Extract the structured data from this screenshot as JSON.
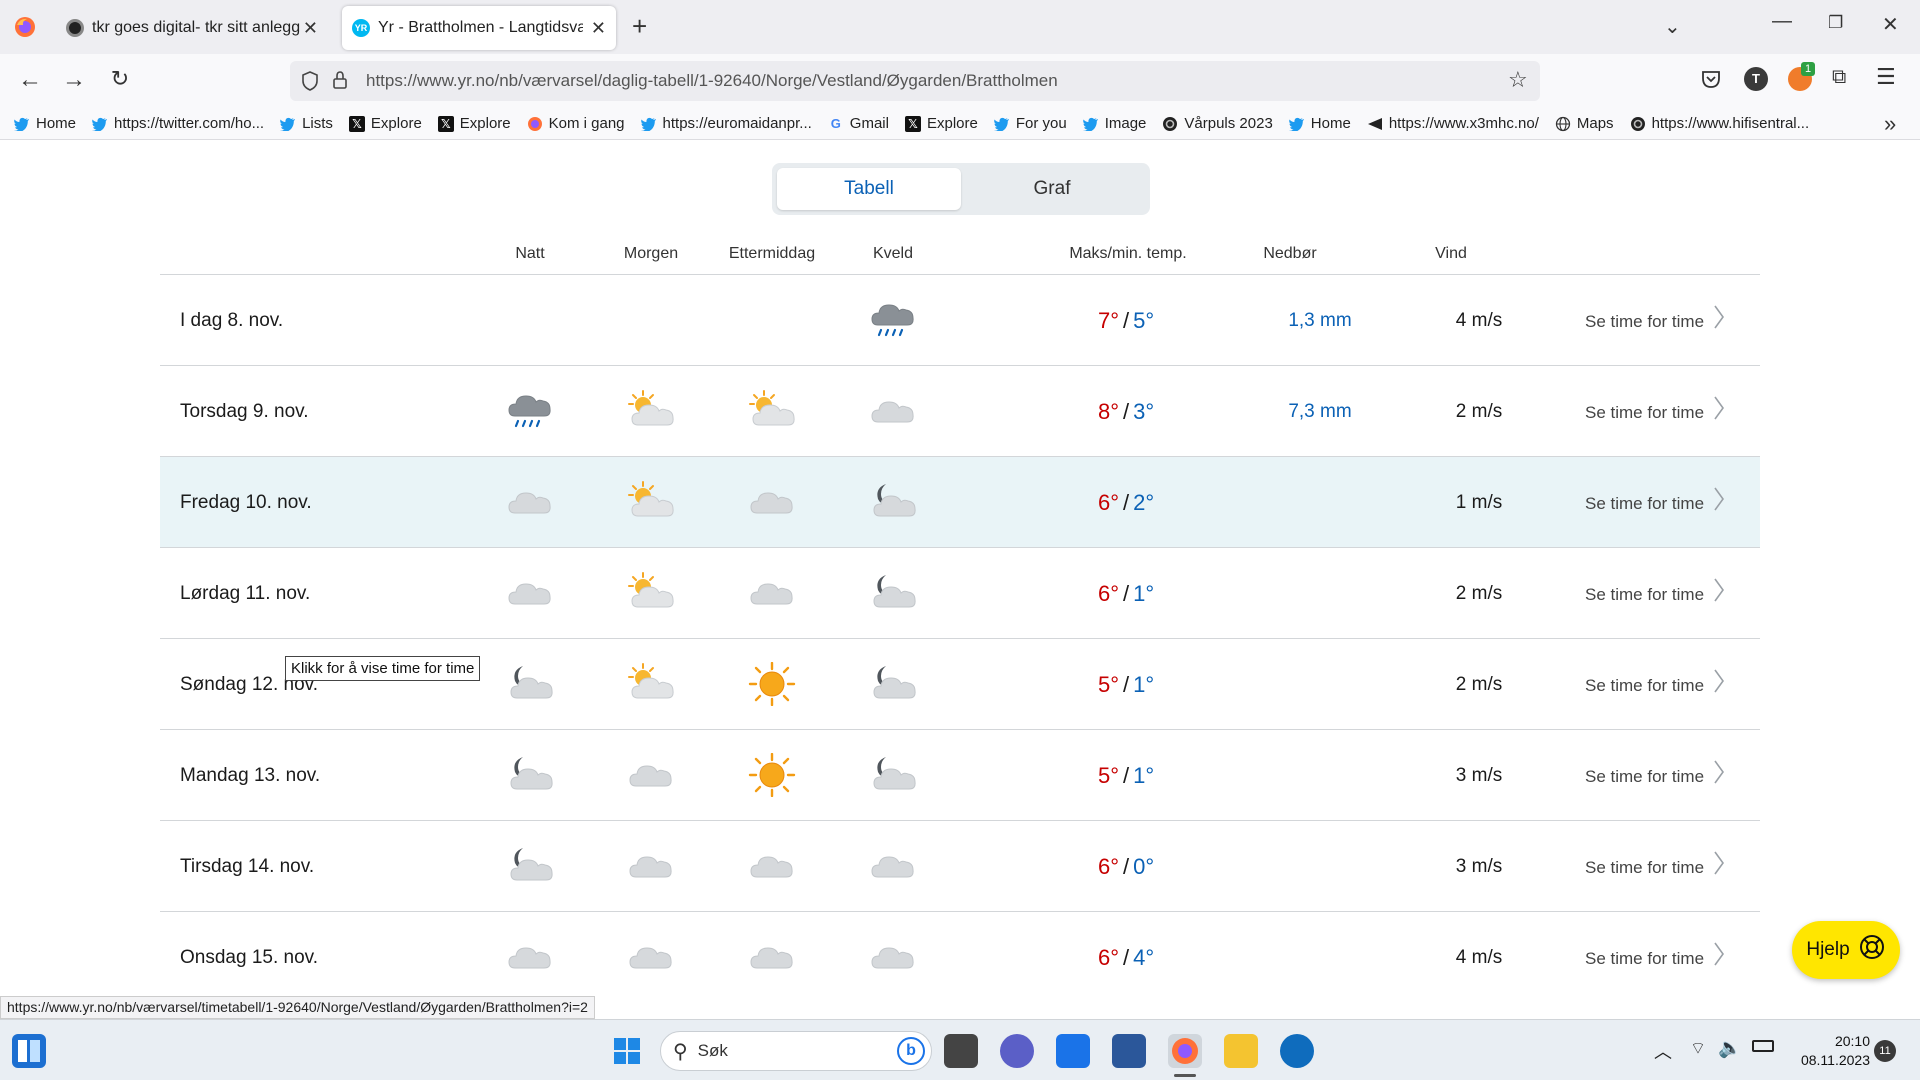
{
  "browser": {
    "tabs": [
      {
        "title": "tkr goes digital- tkr sitt anlegg",
        "active": false
      },
      {
        "title": "Yr - Brattholmen - Langtidsvarsel",
        "active": true
      }
    ],
    "new_tab": "+",
    "url": "https://www.yr.no/nb/værvarsel/daglig-tabell/1-92640/Norge/Vestland/Øygarden/Brattholmen",
    "profile_letter": "T",
    "extension_badge": "1",
    "bookmarks": [
      {
        "label": "Home",
        "icon": "twitter-icon"
      },
      {
        "label": "https://twitter.com/ho...",
        "icon": "twitter-icon"
      },
      {
        "label": "Lists",
        "icon": "twitter-icon"
      },
      {
        "label": "Explore",
        "icon": "x-icon"
      },
      {
        "label": "Explore",
        "icon": "x-icon"
      },
      {
        "label": "Kom i gang",
        "icon": "firefox-icon"
      },
      {
        "label": "https://euromaidanpr...",
        "icon": "twitter-icon"
      },
      {
        "label": "Gmail",
        "icon": "google-icon"
      },
      {
        "label": "Explore",
        "icon": "x-icon"
      },
      {
        "label": "For you",
        "icon": "twitter-icon"
      },
      {
        "label": "Image",
        "icon": "twitter-icon"
      },
      {
        "label": "Vårpuls 2023",
        "icon": "circle-icon"
      },
      {
        "label": "Home",
        "icon": "twitter-icon"
      },
      {
        "label": "https://www.x3mhc.no/",
        "icon": "triangle-icon"
      },
      {
        "label": "Maps",
        "icon": "globe-icon"
      },
      {
        "label": "https://www.hifisentral...",
        "icon": "circle-icon"
      }
    ],
    "overflow": "»",
    "status_url": "https://www.yr.no/nb/værvarsel/timetabell/1-92640/Norge/Vestland/Øygarden/Brattholmen?i=2"
  },
  "page": {
    "toggle": {
      "table_label": "Tabell",
      "graph_label": "Graf",
      "selected": "Tabell"
    },
    "columns": {
      "night": "Natt",
      "morning": "Morgen",
      "afternoon": "Ettermiddag",
      "evening": "Kveld",
      "temp": "Maks/min. temp.",
      "precip": "Nedbør",
      "wind": "Vind"
    },
    "rows": [
      {
        "day": "I dag 8. nov.",
        "icons": [
          "",
          "",
          "",
          "rain-cloud-icon"
        ],
        "max": "7°",
        "min": "5°",
        "precip": "1,3 mm",
        "wind": "4 m/s",
        "link": "Se time for time"
      },
      {
        "day": "Torsdag 9. nov.",
        "icons": [
          "rain-cloud-icon",
          "sun-cloud-icon",
          "sun-cloud-icon",
          "cloud-icon"
        ],
        "max": "8°",
        "min": "3°",
        "precip": "7,3 mm",
        "wind": "2 m/s",
        "link": "Se time for time"
      },
      {
        "day": "Fredag 10. nov.",
        "icons": [
          "cloud-icon",
          "sun-cloud-icon",
          "cloud-icon",
          "moon-cloud-icon"
        ],
        "max": "6°",
        "min": "2°",
        "precip": "",
        "wind": "1 m/s",
        "link": "Se time for time",
        "highlighted": true
      },
      {
        "day": "Lørdag 11. nov.",
        "icons": [
          "cloud-icon",
          "sun-cloud-icon",
          "cloud-icon",
          "moon-cloud-icon"
        ],
        "max": "6°",
        "min": "1°",
        "precip": "",
        "wind": "2 m/s",
        "link": "Se time for time"
      },
      {
        "day": "Søndag 12. nov.",
        "icons": [
          "moon-cloud-icon",
          "sun-cloud-icon",
          "sun-icon",
          "moon-cloud-icon"
        ],
        "max": "5°",
        "min": "1°",
        "precip": "",
        "wind": "2 m/s",
        "link": "Se time for time"
      },
      {
        "day": "Mandag 13. nov.",
        "icons": [
          "moon-cloud-icon",
          "cloud-icon",
          "sun-icon",
          "moon-cloud-icon"
        ],
        "max": "5°",
        "min": "1°",
        "precip": "",
        "wind": "3 m/s",
        "link": "Se time for time"
      },
      {
        "day": "Tirsdag 14. nov.",
        "icons": [
          "moon-cloud-icon",
          "cloud-icon",
          "cloud-icon",
          "cloud-icon"
        ],
        "max": "6°",
        "min": "0°",
        "precip": "",
        "wind": "3 m/s",
        "link": "Se time for time"
      },
      {
        "day": "Onsdag 15. nov.",
        "icons": [
          "cloud-icon",
          "cloud-icon",
          "cloud-icon",
          "cloud-icon"
        ],
        "max": "6°",
        "min": "4°",
        "precip": "",
        "wind": "4 m/s",
        "link": "Se time for time"
      }
    ],
    "temp_separator": "/",
    "tooltip": "Klikk for å vise time for time",
    "help_label": "Hjelp"
  },
  "taskbar": {
    "search_placeholder": "Søk",
    "time": "20:10",
    "date": "08.11.2023",
    "notifications": "11"
  },
  "colors": {
    "temp_max": "#c60000",
    "temp_min": "#0b61b5",
    "precip": "#0b61b5",
    "highlight_row": "#e9f4f7",
    "help_button": "#ffe600"
  }
}
